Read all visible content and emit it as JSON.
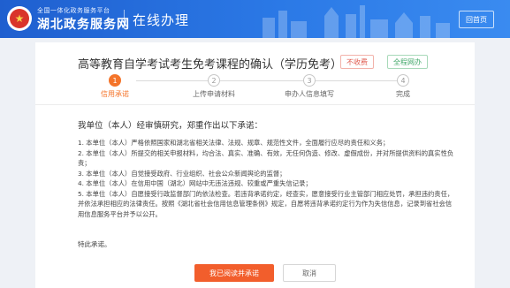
{
  "header": {
    "brand_sub": "全国一体化政务服务平台",
    "brand_main": "湖北政务服务网",
    "page_title": "在线办理",
    "home_button": "回首页",
    "emblem_glyph": "★",
    "accent_color": "#2b79e6"
  },
  "service": {
    "title": "高等教育自学考试考生免考课程的确认（学历免考）",
    "badge_fee": "不收费",
    "badge_online": "全程网办"
  },
  "steps": [
    {
      "number": "1",
      "label": "信用承诺",
      "active": true
    },
    {
      "number": "2",
      "label": "上传申请材料",
      "active": false
    },
    {
      "number": "3",
      "label": "申办人信息填写",
      "active": false
    },
    {
      "number": "4",
      "label": "完成",
      "active": false
    }
  ],
  "commitment": {
    "intro": "我单位（本人）经审慎研究，郑重作出以下承诺：",
    "items": [
      "1. 本单位（本人）严格依照国家和湖北省相关法律、法规、规章、规范性文件，全面履行应尽的责任和义务；",
      "2. 本单位（本人）所提交的相关申报材料，均合法、真实、准确、有效，无任何伪造、修改、虚假成份，并对所提供资料的真实性负责；",
      "3. 本单位（本人）自觉接受政府、行业组织、社会公众新闻舆论的监督；",
      "4. 本单位（本人）在信用中国（湖北）网站中无违法违规、较重或严重失信记录；",
      "5. 本单位（本人）自愿接受行政监督部门的依法检查。若违背承诺约定，经查实，愿意接受行业主管部门相应处罚，承担违约责任，并依法承担相应的法律责任。按照《湖北省社会信用信息管理条例》规定，自愿将违背承诺约定行为作为失信信息，记录到省社会信用信息服务平台并予以公开。"
    ],
    "closing": "特此承诺。"
  },
  "actions": {
    "agree": "我已阅读并承诺",
    "cancel": "取消"
  }
}
